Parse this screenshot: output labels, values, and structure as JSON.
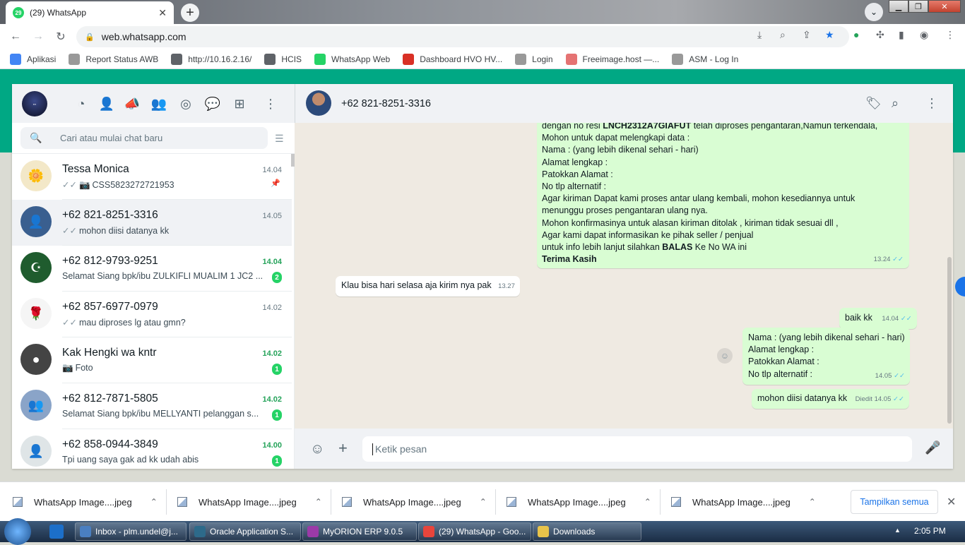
{
  "browser": {
    "tab_title": "(29) WhatsApp",
    "tab_badge": "29",
    "url": "web.whatsapp.com",
    "bookmarks": [
      {
        "label": "Aplikasi",
        "icon": "apps-grid-icon",
        "color": "#4285f4"
      },
      {
        "label": "Report Status AWB",
        "icon": "page-icon",
        "color": "#999999"
      },
      {
        "label": "http://10.16.2.16/",
        "icon": "globe-icon",
        "color": "#5f6368"
      },
      {
        "label": "HCIS",
        "icon": "globe-icon",
        "color": "#5f6368"
      },
      {
        "label": "WhatsApp Web",
        "icon": "whatsapp-icon",
        "color": "#25d366"
      },
      {
        "label": "Dashboard HVO HV...",
        "icon": "doc-icon",
        "color": "#d93025"
      },
      {
        "label": "Login",
        "icon": "page-icon",
        "color": "#999999"
      },
      {
        "label": "Freeimage.host —...",
        "icon": "freeimage-icon",
        "color": "#e57373"
      },
      {
        "label": "ASM - Log In",
        "icon": "page-icon",
        "color": "#999999"
      }
    ]
  },
  "sidebar": {
    "search_placeholder": "Cari atau mulai chat baru",
    "chats": [
      {
        "name": "Tessa Monica",
        "time": "14.04",
        "ticks": "✓✓",
        "media": "📷",
        "preview": "CSS5823272721953",
        "pinned": true,
        "unread": "",
        "av_bg": "#f3e8c8",
        "av_glyph": "🌼"
      },
      {
        "name": "+62 821-8251-3316",
        "time": "14.05",
        "ticks": "✓✓",
        "media": "",
        "preview": "mohon diisi datanya kk",
        "pinned": false,
        "unread": "",
        "active": true,
        "av_bg": "#3a5f8f",
        "av_glyph": "👤"
      },
      {
        "name": "+62 812-9793-9251",
        "time": "14.04",
        "ticks": "",
        "media": "",
        "preview": "Selamat Siang   bpk/ibu ZULKIFLI MUALIM 1 JC2 ...",
        "pinned": false,
        "unread": "2",
        "av_bg": "#1f5c2e",
        "av_glyph": "☪"
      },
      {
        "name": "+62 857-6977-0979",
        "time": "14.02",
        "ticks": "✓✓",
        "media": "",
        "preview": "mau diproses lg atau gmn?",
        "pinned": false,
        "unread": "",
        "av_bg": "#f5f5f5",
        "av_glyph": "🌹"
      },
      {
        "name": "Kak Hengki wa kntr",
        "time": "14.02",
        "ticks": "",
        "media": "📷",
        "preview": "Foto",
        "pinned": false,
        "unread": "1",
        "av_bg": "#444444",
        "av_glyph": "●"
      },
      {
        "name": "+62 812-7871-5805",
        "time": "14.02",
        "ticks": "",
        "media": "",
        "preview": "Selamat Siang   bpk/ibu MELLYANTI pelanggan s...",
        "pinned": false,
        "unread": "1",
        "av_bg": "#8aa4c8",
        "av_glyph": "👥"
      },
      {
        "name": "+62 858-0944-3849",
        "time": "14.00",
        "ticks": "",
        "media": "",
        "preview": "Tpi uang saya gak ad kk udah abis",
        "pinned": false,
        "unread": "1",
        "av_bg": "#dfe5e7",
        "av_glyph": "👤"
      }
    ]
  },
  "conversation": {
    "contact": "+62 821-8251-3316",
    "big_message": {
      "line0_a": "dengan no resi ",
      "line0_b": "LNCH2312A7GIAFUT",
      "line0_c": " telah diproses pengantaran,Namun terkendala,",
      "lines": [
        "Mohon untuk dapat melengkapi data :",
        "Nama : (yang lebih dikenal sehari - hari)",
        "Alamat  lengkap :",
        "Patokkan Alamat :",
        "No tlp alternatif :",
        "Agar kiriman Dapat kami proses antar ulang kembali, mohon kesediannya untuk",
        "menunggu proses pengantaran ulang nya.",
        "Mohon konfirmasinya untuk alasan kiriman ditolak , kiriman tidak sesuai dll ,",
        "Agar kami dapat informasikan ke pihak seller / penjual"
      ],
      "last_a": "untuk info lebih lanjut silahkan ",
      "last_b": "BALAS",
      "last_c": " Ke No WA ini",
      "closing": "Terima Kasih",
      "time": "13.24"
    },
    "msg2": {
      "text": "Klau bisa hari selasa aja  kirim nya pak",
      "time": "13.27"
    },
    "msg3": {
      "text": "baik kk",
      "time": "14.04"
    },
    "msg4": {
      "lines": [
        "Nama : (yang lebih dikenal sehari - hari)",
        "Alamat  lengkap :",
        "Patokkan Alamat :",
        "No tlp alternatif :"
      ],
      "time": "14.05"
    },
    "msg5": {
      "text": "mohon diisi datanya kk",
      "edited": "Diedit",
      "time": "14.05"
    },
    "composer_placeholder": "Ketik pesan"
  },
  "downloads": {
    "items": [
      "WhatsApp Image....jpeg",
      "WhatsApp Image....jpeg",
      "WhatsApp Image....jpeg",
      "WhatsApp Image....jpeg",
      "WhatsApp Image....jpeg"
    ],
    "show_all": "Tampilkan semua"
  },
  "taskbar": {
    "items": [
      {
        "label": "Inbox - plm.undel@j...",
        "color": "#4a7fc1"
      },
      {
        "label": "Oracle Application S...",
        "color": "#2d6a8a"
      },
      {
        "label": "MyORION ERP 9.0.5",
        "color": "#9b3aa8"
      },
      {
        "label": "(29) WhatsApp - Goo...",
        "color": "#e8453c"
      },
      {
        "label": "Downloads",
        "color": "#e8c34a"
      }
    ],
    "clock": "2:05 PM"
  }
}
